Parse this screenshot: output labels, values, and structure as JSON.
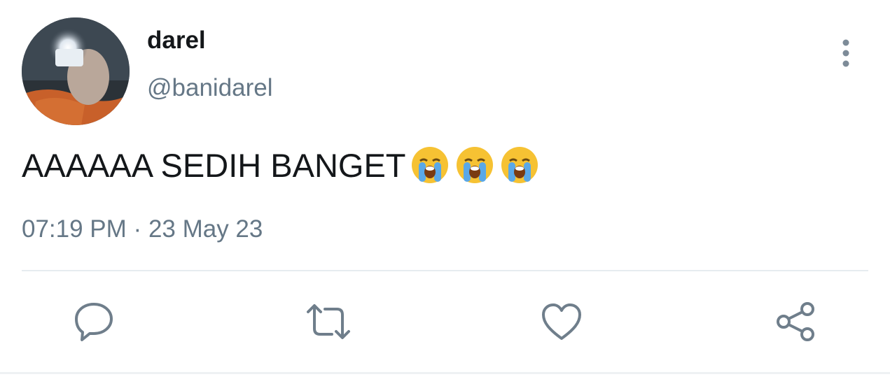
{
  "tweet": {
    "display_name": "darel",
    "handle": "@banidarel",
    "text": "AAAAAA SEDIH BANGET",
    "emojis": [
      "loudly-crying-face",
      "loudly-crying-face",
      "loudly-crying-face"
    ],
    "time": "07:19 PM",
    "separator": "·",
    "date": "23 May 23"
  },
  "actions": [
    {
      "name": "reply",
      "icon": "reply-icon"
    },
    {
      "name": "retweet",
      "icon": "retweet-icon"
    },
    {
      "name": "like",
      "icon": "heart-icon"
    },
    {
      "name": "share",
      "icon": "share-icon"
    }
  ],
  "colors": {
    "text": "#14171a",
    "secondary": "#657786",
    "divider": "#e6ecf0"
  }
}
